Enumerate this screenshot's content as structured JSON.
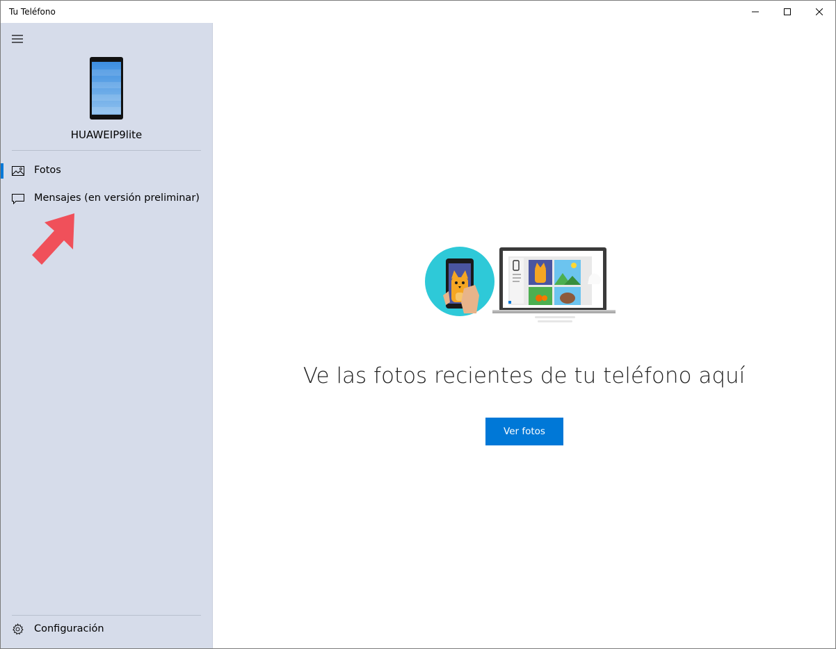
{
  "window": {
    "title": "Tu Teléfono"
  },
  "sidebar": {
    "device_name": "HUAWEIP9lite",
    "nav": [
      {
        "label": "Fotos",
        "icon": "photos-icon",
        "selected": true
      },
      {
        "label": "Mensajes (en versión preliminar)",
        "icon": "message-icon",
        "selected": false
      }
    ],
    "settings_label": "Configuración"
  },
  "main": {
    "headline": "Ve las fotos recientes de tu teléfono aquí",
    "button_label": "Ver fotos"
  },
  "colors": {
    "sidebar_bg": "#d6dcea",
    "accent": "#0078d7",
    "annotation_arrow": "#f0505a"
  },
  "icons": {
    "menu": "hamburger-icon",
    "device": "smartphone-icon",
    "settings": "gear-icon",
    "minimize": "minimize-icon",
    "maximize": "maximize-icon",
    "close": "close-icon"
  }
}
